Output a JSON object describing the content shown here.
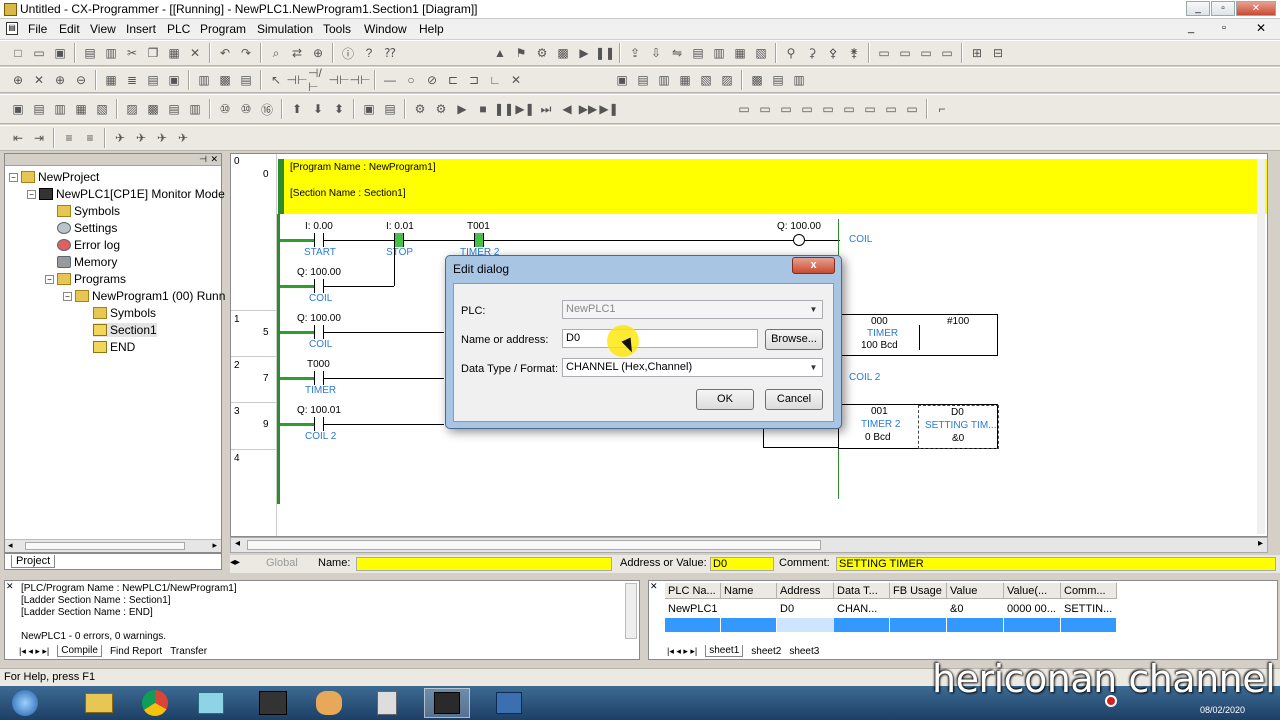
{
  "window": {
    "title": "Untitled - CX-Programmer - [[Running] - NewPLC1.NewProgram1.Section1 [Diagram]]",
    "controls": [
      "minimize",
      "restore",
      "close"
    ]
  },
  "menu": [
    "File",
    "Edit",
    "View",
    "Insert",
    "PLC",
    "Program",
    "Simulation",
    "Tools",
    "Window",
    "Help"
  ],
  "project_tree": {
    "items": [
      {
        "label": "NewProject",
        "icon": "project-icon"
      },
      {
        "label": "NewPLC1[CP1E] Monitor Mode",
        "icon": "plc-icon"
      },
      {
        "label": "Symbols",
        "icon": "symbols-icon"
      },
      {
        "label": "Settings",
        "icon": "settings-icon"
      },
      {
        "label": "Error log",
        "icon": "error-log-icon"
      },
      {
        "label": "Memory",
        "icon": "memory-icon"
      },
      {
        "label": "Programs",
        "icon": "programs-icon"
      },
      {
        "label": "NewProgram1 (00) Runn",
        "icon": "program-icon"
      },
      {
        "label": "Symbols",
        "icon": "symbols-icon"
      },
      {
        "label": "Section1",
        "icon": "section-icon"
      },
      {
        "label": "END",
        "icon": "section-icon"
      }
    ],
    "tab": "Project"
  },
  "ladder": {
    "header_rung": "0",
    "header_step": "0",
    "program_name": "[Program Name : NewProgram1]",
    "section_name": "[Section Name : Section1]",
    "rungs": [
      {
        "rung": "1",
        "step": "5"
      },
      {
        "rung": "2",
        "step": "7"
      },
      {
        "rung": "3",
        "step": "9"
      },
      {
        "rung": "4",
        "step": ""
      }
    ],
    "contacts": [
      {
        "addr": "I: 0.00",
        "comment": "START"
      },
      {
        "addr": "I: 0.01",
        "comment": "STOP"
      },
      {
        "addr": "T001",
        "comment": "TIMER 2"
      },
      {
        "addr": "Q: 100.00",
        "comment": "COIL"
      },
      {
        "addr": "Q: 100.00",
        "comment": "COIL"
      },
      {
        "addr": "T000",
        "comment": "TIMER"
      },
      {
        "addr": "Q: 100.01",
        "comment": "COIL 2"
      }
    ],
    "coil1": {
      "addr": "Q: 100.00",
      "comment": "COIL"
    },
    "coil2": {
      "comment": "COIL 2"
    },
    "tim1": {
      "num": "000",
      "comment": "TIMER",
      "value": "100 Bcd",
      "set": "#100"
    },
    "tim2": {
      "num": "001",
      "comment": "TIMER 2",
      "value": "0 Bcd",
      "set_addr": "D0",
      "set_comment": "SETTING TIM...",
      "set_value": "&0"
    }
  },
  "namebar": {
    "global_tab": "Global",
    "name_label": "Name:",
    "name_value": "",
    "address_label": "Address or Value:",
    "address_value": "D0",
    "comment_label": "Comment:",
    "comment_value": "SETTING TIMER"
  },
  "output": {
    "lines": [
      "[PLC/Program Name : NewPLC1/NewProgram1]",
      "[Ladder Section Name : Section1]",
      "[Ladder Section Name : END]",
      "",
      "NewPLC1 - 0 errors, 0 warnings."
    ],
    "tabs": [
      "Compile",
      "Find Report",
      "Transfer"
    ]
  },
  "watch": {
    "headers": [
      "PLC Na...",
      "Name",
      "Address",
      "Data T...",
      "FB Usage",
      "Value",
      "Value(...",
      "Comm..."
    ],
    "rows": [
      [
        "NewPLC1",
        "",
        "D0",
        "CHAN...",
        "",
        "&0",
        "0000 00...",
        "SETTIN..."
      ]
    ],
    "tabs": [
      "sheet1",
      "sheet2",
      "sheet3"
    ]
  },
  "status": {
    "text": "For Help, press F1"
  },
  "dialog": {
    "title": "Edit dialog",
    "close": "x",
    "plc_label": "PLC:",
    "plc_value": "NewPLC1",
    "name_label": "Name or address:",
    "name_value": "D0",
    "browse": "Browse...",
    "type_label": "Data Type / Format:",
    "type_value": "CHANNEL (Hex,Channel)",
    "ok": "OK",
    "cancel": "Cancel"
  },
  "watermark": "hericonan channel",
  "clock": {
    "date": "08/02/2020"
  }
}
